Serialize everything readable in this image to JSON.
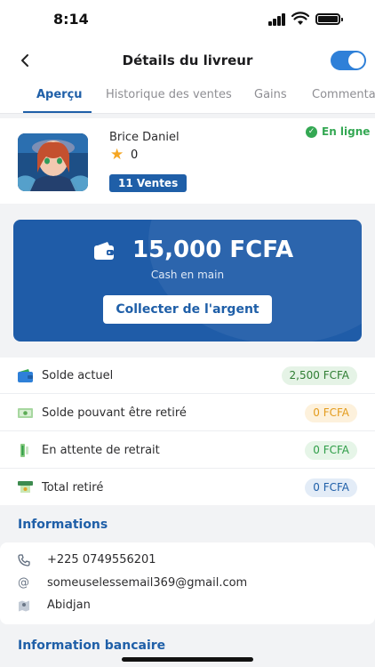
{
  "status_bar": {
    "time": "8:14"
  },
  "header": {
    "title": "Détails du livreur",
    "toggle_on": true
  },
  "tabs": [
    {
      "label": "Aperçu",
      "active": true
    },
    {
      "label": "Historique des ventes",
      "active": false
    },
    {
      "label": "Gains",
      "active": false
    },
    {
      "label": "Commentaires",
      "active": false
    }
  ],
  "profile": {
    "name": "Brice Daniel",
    "rating": "0",
    "sales_badge": "11 Ventes",
    "status": "En ligne"
  },
  "cash_card": {
    "amount": "15,000 FCFA",
    "label": "Cash en main",
    "button": "Collecter de l'argent"
  },
  "balances": [
    {
      "label": "Solde actuel",
      "value": "2,500 FCFA",
      "icon": "wallet-icon",
      "color": "#2e7d32",
      "bg": "#e5f3e6"
    },
    {
      "label": "Solde pouvant être retiré",
      "value": "0 FCFA",
      "icon": "money-icon",
      "color": "#e39b1c",
      "bg": "#fdf1dc"
    },
    {
      "label": "En attente de retrait",
      "value": "0 FCFA",
      "icon": "pending-icon",
      "color": "#2e9d47",
      "bg": "#e6f5e8"
    },
    {
      "label": "Total retiré",
      "value": "0 FCFA",
      "icon": "withdrawn-icon",
      "color": "#1f5fa8",
      "bg": "#e3ecf7"
    }
  ],
  "informations": {
    "title": "Informations",
    "phone": "+225 0749556201",
    "email": "someuselessemail369@gmail.com",
    "city": "Abidjan"
  },
  "bank": {
    "title": "Information bancaire"
  },
  "colors": {
    "accent": "#1f5fa8",
    "online": "#34a853",
    "card": "#1f5ca8"
  }
}
